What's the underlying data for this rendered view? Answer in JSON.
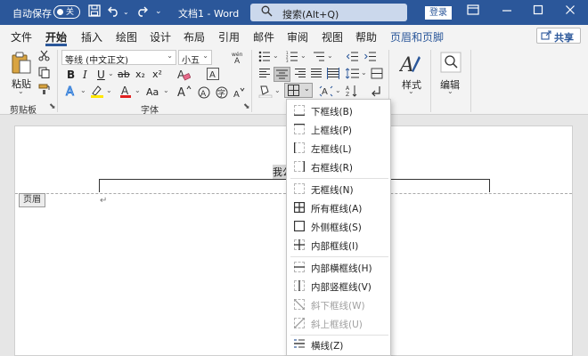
{
  "titlebar": {
    "autosave_label": "自动保存",
    "autosave_state": "关",
    "doc_title": "文档1  -  Word",
    "search_placeholder": "搜索(Alt+Q)",
    "login_label": "登录",
    "icons": [
      "save-icon",
      "undo-icon",
      "redo-icon",
      "customize-icon",
      "search-icon",
      "minimize-icon",
      "restore-icon",
      "close-icon"
    ]
  },
  "tabs": {
    "file": "文件",
    "home": "开始",
    "insert": "插入",
    "draw": "绘图",
    "design": "设计",
    "layout": "布局",
    "references": "引用",
    "mailings": "邮件",
    "review": "审阅",
    "view": "视图",
    "help": "帮助",
    "header_footer": "页眉和页脚",
    "share": "共享"
  },
  "ribbon": {
    "paste_label": "粘贴",
    "clipboard_label": "剪贴板",
    "font_name": "等线 (中文正文)",
    "font_size": "小五",
    "font_group_label": "字体",
    "styles_label": "样式",
    "editing_label": "编辑",
    "bold": "B",
    "italic": "I",
    "underline": "U",
    "strike": "ab",
    "subscript": "x₂",
    "superscript": "x²",
    "font_grow": "A",
    "font_shrink": "A",
    "case": "Aa",
    "clear": "A",
    "phonetic": "wén",
    "char_border": "A",
    "enclose": "字",
    "effects": "A",
    "highlight": "ab",
    "font_color": "A",
    "char_shade": "A",
    "accent_color": "#2b579a"
  },
  "document": {
    "header_text": "我公",
    "header_tag": "页眉",
    "para_mark": "↵"
  },
  "borders_menu": {
    "items": [
      {
        "label": "下框线(B)",
        "disabled": false
      },
      {
        "label": "上框线(P)",
        "disabled": false
      },
      {
        "label": "左框线(L)",
        "disabled": false
      },
      {
        "label": "右框线(R)",
        "disabled": false
      },
      {
        "label": "无框线(N)",
        "disabled": false
      },
      {
        "label": "所有框线(A)",
        "disabled": false
      },
      {
        "label": "外侧框线(S)",
        "disabled": false
      },
      {
        "label": "内部框线(I)",
        "disabled": false
      },
      {
        "label": "内部横框线(H)",
        "disabled": false
      },
      {
        "label": "内部竖框线(V)",
        "disabled": false
      },
      {
        "label": "斜下框线(W)",
        "disabled": true
      },
      {
        "label": "斜上框线(U)",
        "disabled": true
      },
      {
        "label": "横线(Z)",
        "disabled": false
      }
    ]
  }
}
